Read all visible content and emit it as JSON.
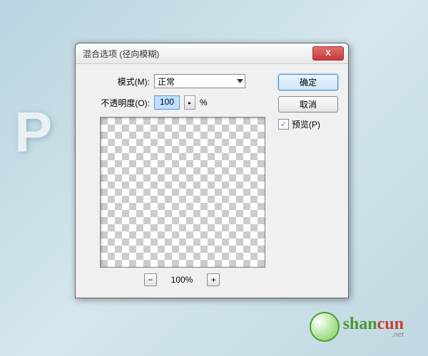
{
  "dialog": {
    "title": "混合选项 (径向模糊)",
    "mode_label": "模式(M):",
    "mode_value": "正常",
    "opacity_label": "不透明度(O):",
    "opacity_value": "100",
    "opacity_unit": "%",
    "zoom_value": "100%",
    "ok_label": "确定",
    "cancel_label": "取消",
    "preview_label": "预览(P)",
    "preview_checked": "✓",
    "minus": "−",
    "plus": "+",
    "close_x": "X",
    "stepper_icon": "▸"
  },
  "watermark": {
    "brand_green": "shan",
    "brand_red": "cun",
    "sub": ".net"
  }
}
